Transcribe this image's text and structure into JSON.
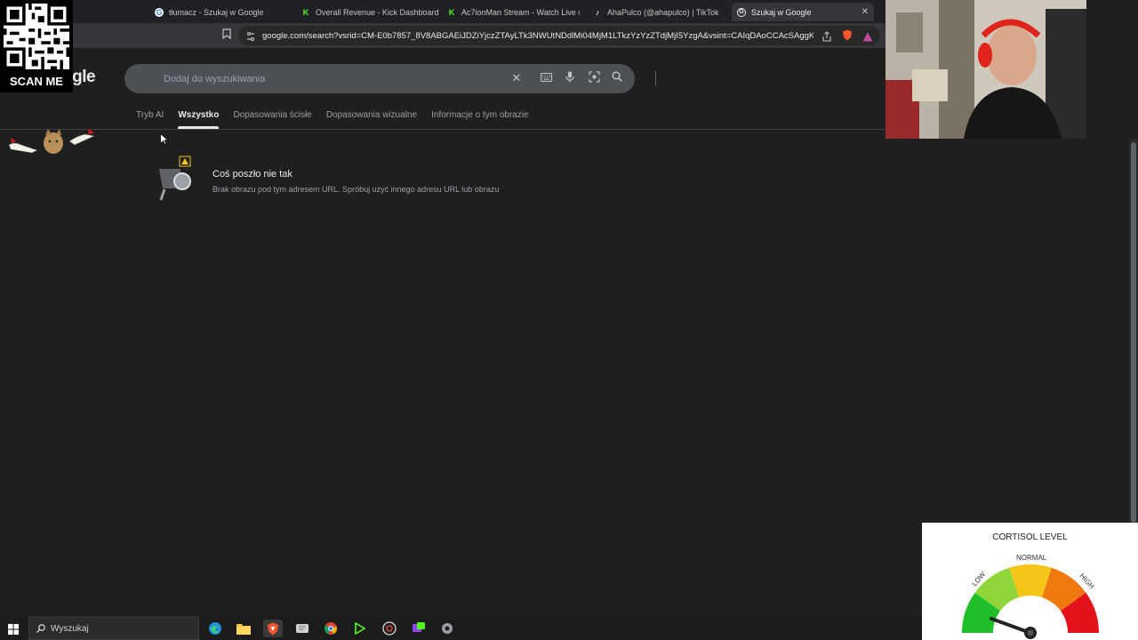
{
  "browser": {
    "tabs": [
      {
        "title": "tłumacz - Szukaj w Google",
        "favicon": "G"
      },
      {
        "title": "Overall Revenue - Kick Dashboard",
        "favicon": "K"
      },
      {
        "title": "Ac7ionMan Stream - Watch Live on K",
        "favicon": "K"
      },
      {
        "title": "AhaPulco (@ahapulco) | TikTok",
        "favicon": "♪"
      },
      {
        "title": "Szukaj w Google",
        "favicon": "G",
        "active": true
      }
    ],
    "url": "google.com/search?vsrid=CM-E0b7857_8V8ABGAEiJDZiYjczZTAyLTk3NWUtNDdlMi04MjM1LTkzYzYzZTdjMjI5YzgA&vsint=CAIqDAoCCAcSAggKGAEg..."
  },
  "google": {
    "logo_fragment": "ogle",
    "search_placeholder": "Dodaj do wyszukiwania",
    "nav_tabs": [
      "Tryb AI",
      "Wszystko",
      "Dopasowania ścisłe",
      "Dopasowania wizualne",
      "Informacje o tym obrazie"
    ],
    "active_tab_index": 1,
    "error_title": "Coś poszło nie tak",
    "error_description": "Brak obrazu pod tym adresem URL. Spróbuj użyć innego adresu URL lub obrazu"
  },
  "overlays": {
    "qr_caption": "SCAN ME",
    "cortisol": {
      "title": "CORTISOL LEVEL",
      "labels": {
        "low": "LOW",
        "normal": "NORMAL",
        "high": "HIGH"
      },
      "colors": {
        "low": "#1fbf2a",
        "mid_low": "#8fd63a",
        "normal": "#f5c518",
        "mid_high": "#f07a10",
        "high": "#e3121b"
      }
    }
  },
  "taskbar": {
    "search_label": "Wyszukaj",
    "apps": [
      "edge-icon",
      "file-explorer-icon",
      "brave-icon",
      "app-icon",
      "chrome-icon",
      "kick-icon",
      "obs-icon",
      "chat-app-icon",
      "settings-app-icon"
    ]
  },
  "colors": {
    "page_bg": "#1f1f1f",
    "toolbar_bg": "#35363a",
    "searchbox_bg": "#4d5156"
  }
}
